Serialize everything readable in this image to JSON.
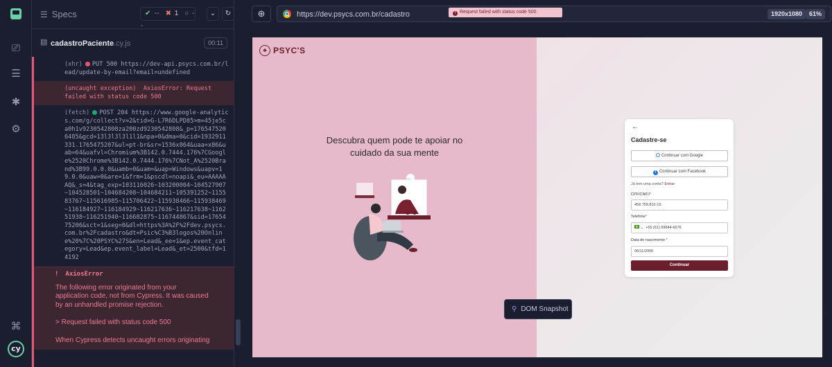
{
  "reporter": {
    "specs_label": "Specs",
    "stats": {
      "passed": "--",
      "failed": "1",
      "pending": "--"
    },
    "file_name": "cadastroPaciente",
    "file_ext": ".cy.js",
    "duration": "00:11"
  },
  "log": [
    {
      "type": "xhr",
      "tag": "(xhr)",
      "method": "PUT 500",
      "text": "https://dev-api.psycs.com.br/lead/update-by-email?email=undefined"
    },
    {
      "type": "exception",
      "tag": "(uncaught exception)",
      "text": "AxiosError: Request failed with status code 500"
    },
    {
      "type": "fetch",
      "tag": "(fetch)",
      "method": "POST 204",
      "text": "https://www.google-analytics.com/g/collect?v=2&tid=G-L7R6DLPD85>m=45je5ca0h1v9230542808za200zd9230542808&_p=1765475206485&gcd=13l3l3l3l1l1&npa=0&dma=0&cid=1932911331.1765475207&ul=pt-br&sr=1536x864&uaa=x86&uab=64&uafvl=Chromium%3B142.0.7444.176%7CGoogle%2520Chrome%3B142.0.7444.176%7CNot_A%2520Brand%3B99.0.0.0&uamb=0&uam=&uap=Windows&uapv=19.0.0&uaw=0&are=1&frm=1&pscdl=noapi&_eu=AAAAAAQ&_s=4&tag_exp=103116026~103200004~104527907~104528501~104684208~104684211~105391252~115583767~115616985~115706422~115938466~115938469~116184927~116184929~116217636~116217638~116251938~116251940~116682875~116744867&sid=1765475206&sct=1&seg=0&dl=https%3A%2F%2Fdev.psycs.com.br%2Fcadastro&dt=Psic%C3%B3logos%20Online%20%7C%20PSYC%27S&en=Lead&_ee=1&ep.event_category=Lead&ep.event_label=Lead&_et=2500&tfd=14192"
    }
  ],
  "error": {
    "title": "AxiosError",
    "p1": "The following error originated from your application code, not from Cypress. It was caused by an unhandled promise rejection.",
    "p2": "> Request failed with status code 500",
    "p3": "When Cypress detects uncaught errors originating"
  },
  "browser": {
    "url": "https://dev.psycs.com.br/cadastro",
    "resolution": "1920x1080",
    "zoom": "61%"
  },
  "app": {
    "brand": "PSYC'S",
    "hero": "Descubra quem pode te apoiar no cuidado da sua mente",
    "toast": "Request failed with status code 500",
    "card": {
      "title": "Cadastre-se",
      "google_btn": "Continuar com Google",
      "facebook_btn": "Continuar com Facebook",
      "already_text": "Já tem uma conta?",
      "enter_link": "Entrar",
      "cpf_label": "CPF/CNPJ",
      "cpf_value": "458.759.810-19",
      "phone_label": "Telefone",
      "phone_value": "+55 (61) 99844-6676",
      "birth_label": "Data de nascimento",
      "birth_value": "06/11/2000",
      "continue_btn": "Continuar"
    }
  },
  "snapshot_label": "DOM Snapshot",
  "colors": {
    "accent": "#6b1e2b",
    "fail": "#e45770",
    "pass": "#69d3a7"
  }
}
